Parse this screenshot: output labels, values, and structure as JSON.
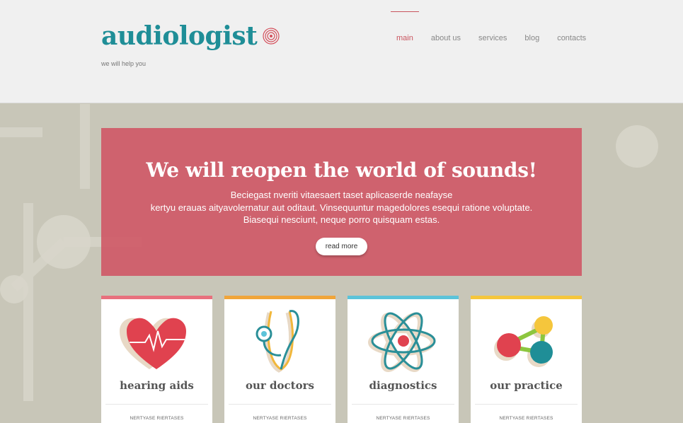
{
  "brand": {
    "name": "audiologist",
    "tagline": "we will help you"
  },
  "nav": {
    "items": [
      "main",
      "about us",
      "services",
      "blog",
      "contacts"
    ],
    "active": "main"
  },
  "hero": {
    "title": "We will reopen the world of sounds!",
    "lines": [
      "Beciegast nveriti vitaesaert taset aplicaserde neafayse",
      "kertyu erauas aityavolernatur aut oditaut. Vinsequuntur magedolores esequi ratione voluptate.",
      "Biasequi nesciunt, neque porro quisquam estas."
    ],
    "button": "read more"
  },
  "cards": [
    {
      "title": "hearing aids",
      "subtitle": "NERTYASE RIERTASES",
      "accent": "#e8707d",
      "icon": "heart-icon"
    },
    {
      "title": "our doctors",
      "subtitle": "NERTYASE RIERTASES",
      "accent": "#f0a53a",
      "icon": "stethoscope-icon"
    },
    {
      "title": "diagnostics",
      "subtitle": "NERTYASE RIERTASES",
      "accent": "#5cc3d9",
      "icon": "atom-icon"
    },
    {
      "title": "our practice",
      "subtitle": "NERTYASE RIERTASES",
      "accent": "#f5c63c",
      "icon": "molecule-icon"
    }
  ],
  "colors": {
    "teal": "#1f8e97",
    "red": "#c9545e",
    "hero_bg": "#cf5463"
  }
}
